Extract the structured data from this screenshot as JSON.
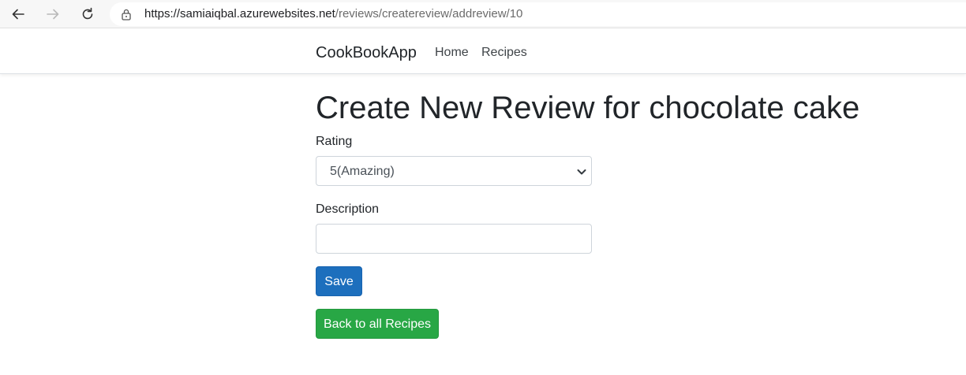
{
  "browser": {
    "url_host": "https://samiaiqbal.azurewebsites.net",
    "url_path": "/reviews/createreview/addreview/10"
  },
  "navbar": {
    "brand": "CookBookApp",
    "links": [
      "Home",
      "Recipes"
    ]
  },
  "page": {
    "title": "Create New Review for chocolate cake"
  },
  "form": {
    "rating_label": "Rating",
    "rating_value": "5(Amazing)",
    "description_label": "Description",
    "description_value": "",
    "save_label": "Save",
    "back_label": "Back to all Recipes"
  },
  "colors": {
    "primary": "#1d6fbd",
    "success": "#28a745",
    "text": "#212529"
  }
}
